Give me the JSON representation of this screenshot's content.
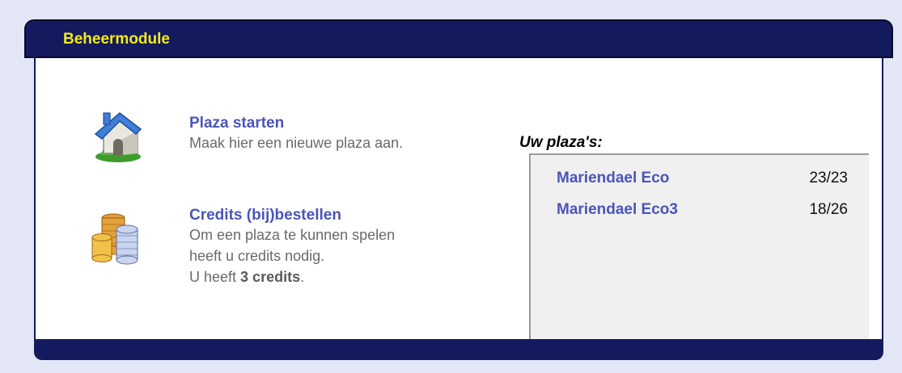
{
  "header": {
    "title": "Beheermodule"
  },
  "actions": [
    {
      "title": "Plaza starten",
      "lines": [
        "Maak hier een nieuwe plaza aan."
      ],
      "icon": "house-icon"
    },
    {
      "title": "Credits (bij)bestellen",
      "lines": [
        "Om een plaza te kunnen spelen",
        "heeft u credits nodig."
      ],
      "credits_prefix": "U heeft ",
      "credits_value": "3 credits",
      "credits_suffix": ".",
      "icon": "coins-icon"
    }
  ],
  "plazas": {
    "heading": "Uw plaza's:",
    "items": [
      {
        "name": "Mariendael Eco",
        "score": "23/23"
      },
      {
        "name": "Mariendael Eco3",
        "score": "18/26"
      }
    ]
  },
  "colors": {
    "header": "#141a5e",
    "title": "#f3ea1a",
    "link": "#4a55b8",
    "page": "#e3e7f5"
  }
}
